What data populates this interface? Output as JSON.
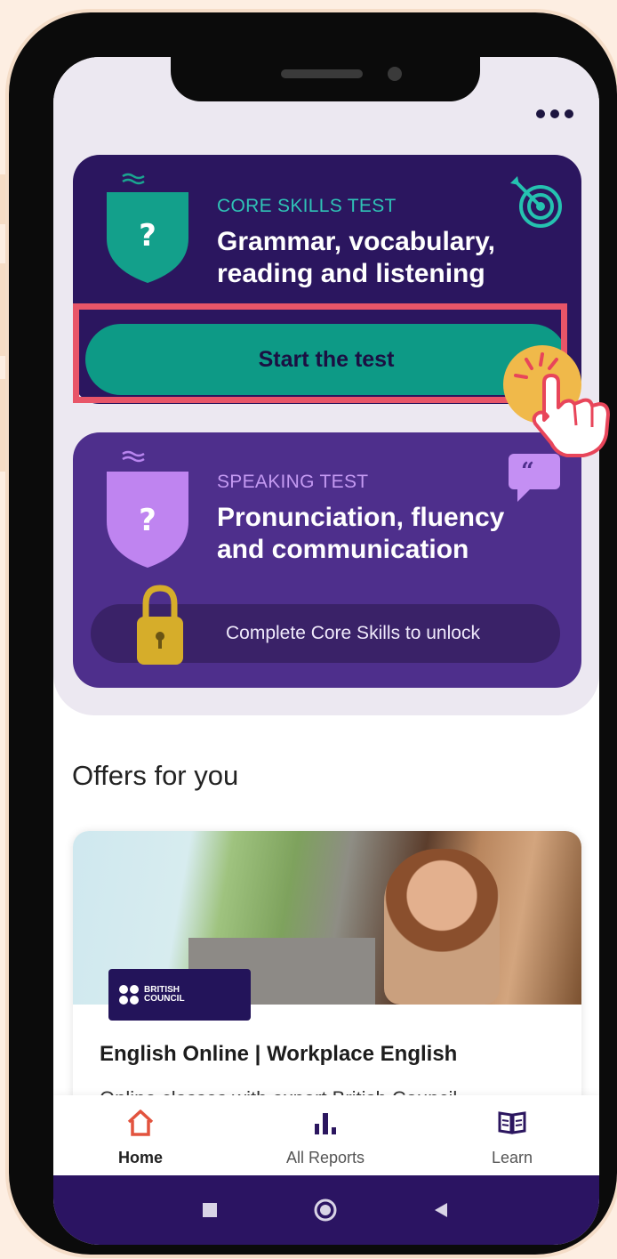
{
  "header": {
    "more_icon": "more-horizontal-icon"
  },
  "core_test": {
    "eyebrow": "CORE SKILLS TEST",
    "title_line1": "Grammar, vocabulary,",
    "title_line2": "reading and listening",
    "start_label": "Start the test",
    "icon": "target-icon",
    "eyebrow_color": "#2fc3b6"
  },
  "speaking_test": {
    "eyebrow": "SPEAKING TEST",
    "title_line1": "Pronunciation, fluency",
    "title_line2": "and communication",
    "lock_label": "Complete Core Skills to unlock",
    "icon": "quote-bubble-icon",
    "eyebrow_color": "#c49af2"
  },
  "offers": {
    "title": "Offers for you",
    "card": {
      "brand_line1": "BRITISH",
      "brand_line2": "COUNCIL",
      "heading": "English Online | Workplace English",
      "subtitle": "Online classes with expert British Council"
    }
  },
  "tabs": [
    {
      "label": "Home",
      "icon": "home-icon",
      "active": true
    },
    {
      "label": "All Reports",
      "icon": "bar-chart-icon",
      "active": false
    },
    {
      "label": "Learn",
      "icon": "book-icon",
      "active": false
    }
  ],
  "colors": {
    "accent_teal": "#0d9a86",
    "brand_dark": "#2b165f",
    "highlight": "#e85568",
    "home_icon": "#e2533e"
  }
}
